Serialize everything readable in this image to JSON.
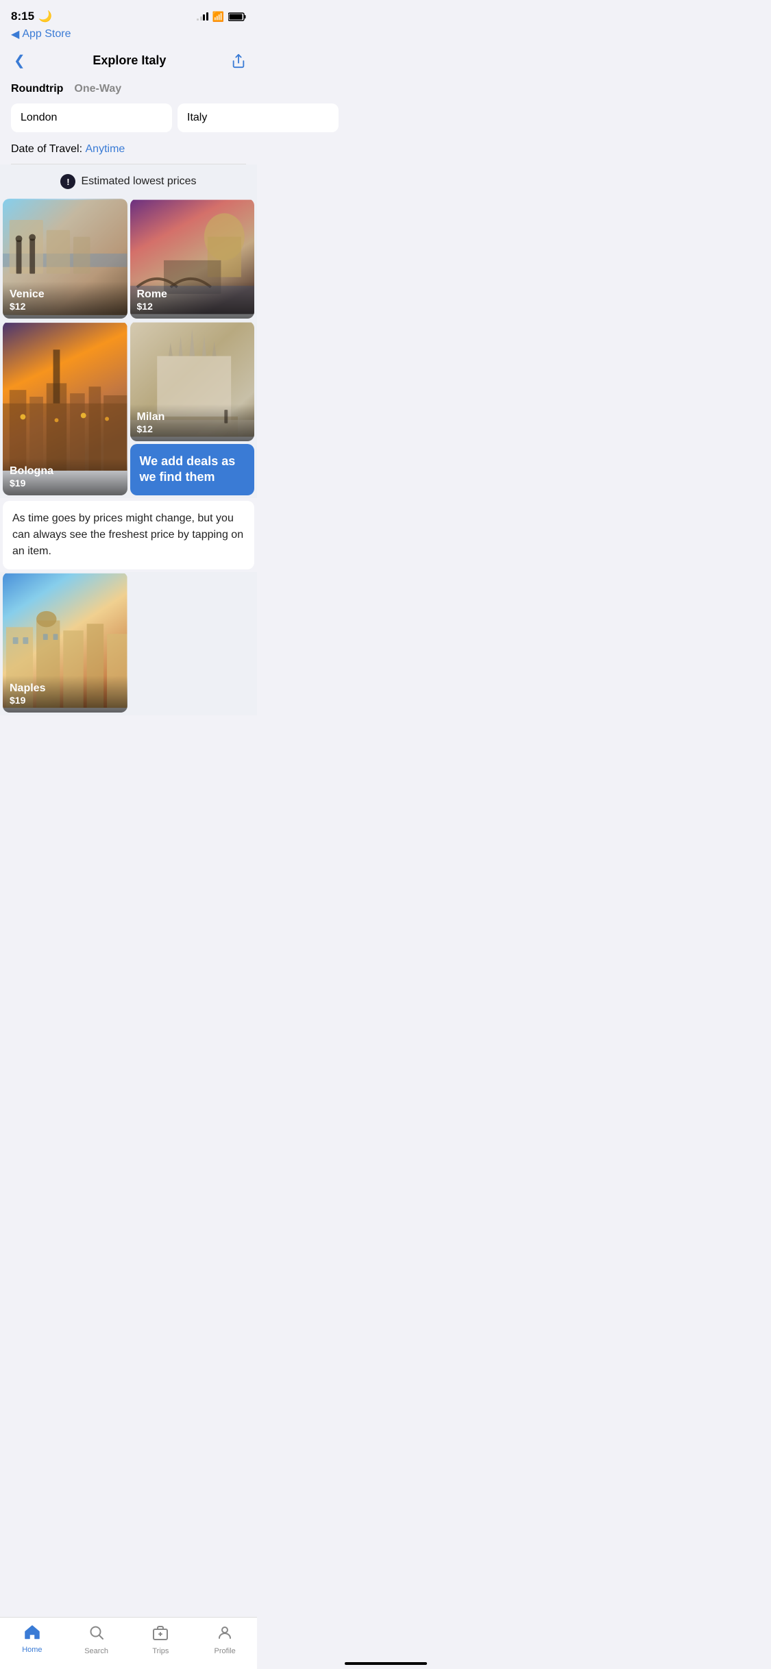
{
  "status": {
    "time": "8:15",
    "moon": "🌙"
  },
  "nav": {
    "back_label": "‹",
    "title": "Explore Italy",
    "app_store_label": "App Store"
  },
  "trip_tabs": {
    "roundtrip": "Roundtrip",
    "one_way": "One-Way"
  },
  "search": {
    "origin": "London",
    "destination": "Italy",
    "date_label": "Date of Travel:",
    "date_value": "Anytime"
  },
  "estimated": {
    "icon": "!",
    "label": "Estimated lowest prices"
  },
  "deals": [
    {
      "city": "Venice",
      "price": "$12",
      "gradient": "venice"
    },
    {
      "city": "Rome",
      "price": "$12",
      "gradient": "rome"
    },
    {
      "city": "Bologna",
      "price": "$19",
      "gradient": "bologna"
    },
    {
      "city": "Milan",
      "price": "$12",
      "gradient": "milan"
    },
    {
      "city": "Naples",
      "price": "$19",
      "gradient": "naples"
    }
  ],
  "info_card": {
    "title": "We add deals as we find them"
  },
  "description": "As time goes by prices might change, but you can always see the freshest price by tapping on an item.",
  "tab_bar": {
    "home": {
      "label": "Home",
      "icon": "🏠"
    },
    "search": {
      "label": "Search",
      "icon": "🔍"
    },
    "trips": {
      "label": "Trips",
      "icon": "🧳"
    },
    "profile": {
      "label": "Profile",
      "icon": "👤"
    }
  }
}
